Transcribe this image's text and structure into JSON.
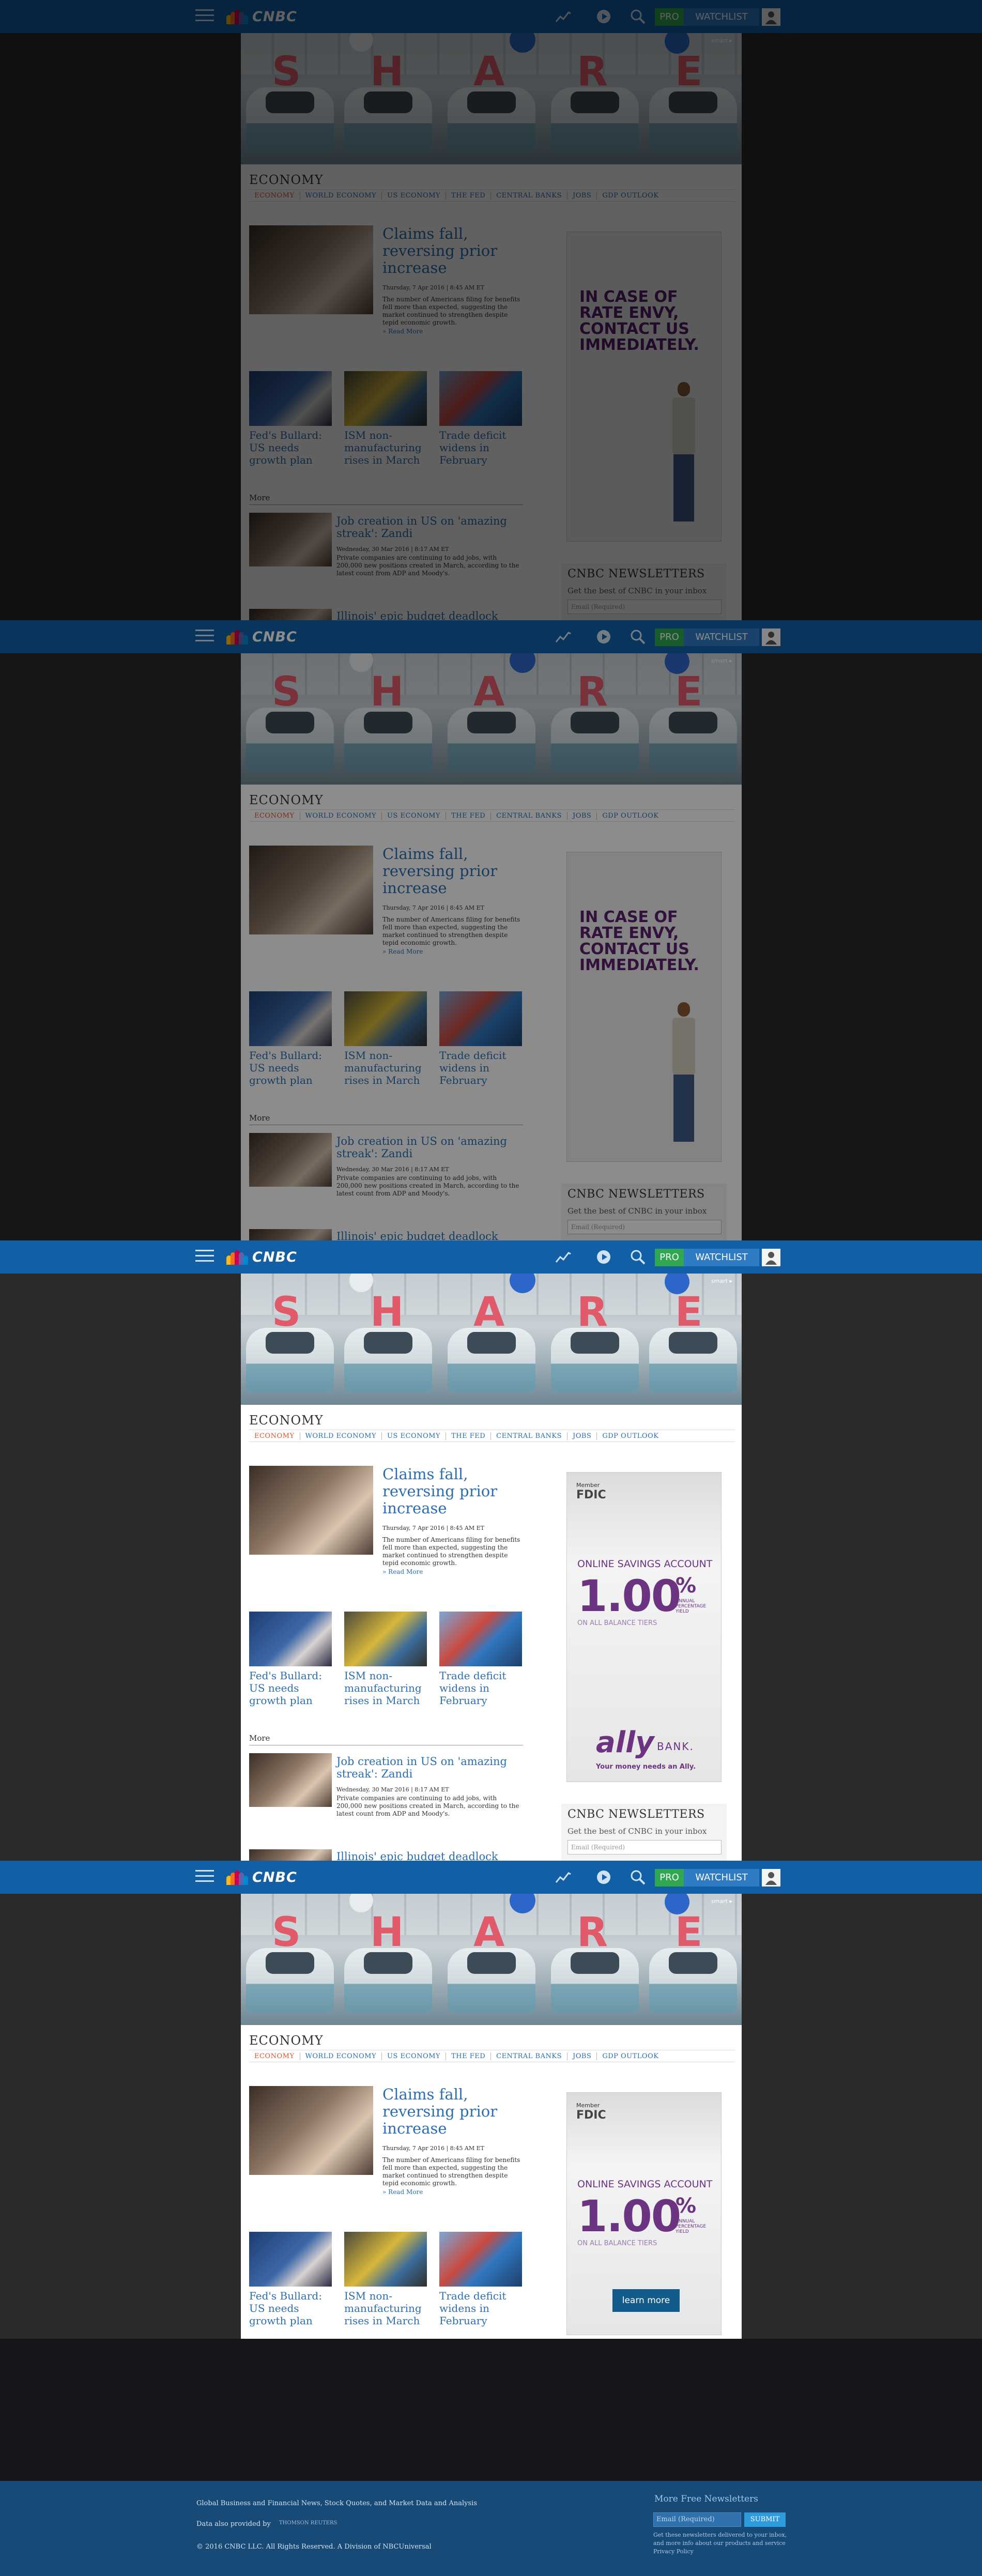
{
  "nav": {
    "logo_text": "CNBC",
    "pro_label": "PRO",
    "watchlist_label": "WATCHLIST"
  },
  "hero": {
    "letters": [
      "S",
      "H",
      "A",
      "R",
      "E"
    ],
    "caption": "smart ▸"
  },
  "section": {
    "title": "ECONOMY",
    "tabs": [
      "ECONOMY",
      "WORLD ECONOMY",
      "US ECONOMY",
      "THE FED",
      "CENTRAL BANKS",
      "JOBS",
      "GDP OUTLOOK"
    ]
  },
  "lead": {
    "headline": "Claims fall, reversing prior increase",
    "date": "Thursday, 7 Apr 2016 | 8:45 AM ET",
    "summary": "The number of Americans filing for benefits fell more than expected, suggesting the market continued to strengthen despite tepid economic growth.",
    "read_more": "» Read More"
  },
  "cards": [
    {
      "title": "Fed's Bullard: US needs growth plan"
    },
    {
      "title": "ISM non-manufacturing rises in March"
    },
    {
      "title": "Trade deficit widens in February"
    }
  ],
  "more": {
    "label": "More",
    "items": [
      {
        "title": "Job creation in US on 'amazing streak': Zandi",
        "date": "Wednesday, 30 Mar 2016 | 8:17 AM ET",
        "summary": "Private companies are continuing to add jobs, with 200,000 new positions created in March, according to the latest count from ADP and Moody's."
      },
      {
        "title": "Illinois' epic budget deadlock"
      }
    ]
  },
  "ads": {
    "rate_envy": "IN CASE OF RATE ENVY, CONTACT US IMMEDIATELY.",
    "member": "Member",
    "fdic": "FDIC",
    "account": "ONLINE SAVINGS ACCOUNT",
    "rate": "1.00",
    "pct": "%",
    "apy": "ANNUAL PERCENTAGE YIELD",
    "tiers": "ON ALL BALANCE TIERS",
    "learn_more": "learn more",
    "brand": "ally",
    "bank": "BANK.",
    "tagline": "Your money needs an Ally."
  },
  "newsletter": {
    "title": "CNBC NEWSLETTERS",
    "subtitle": "Get the best of CNBC in your inbox",
    "placeholder": "Email (Required)"
  },
  "footer": {
    "line1": "Global Business and Financial News, Stock Quotes, and Market Data and Analysis",
    "data_by": "Data also provided by",
    "provider": "THOMSON REUTERS",
    "copyright": "© 2016 CNBC LLC. All Rights Reserved. A Division of NBCUniversal",
    "nl_title": "More Free Newsletters",
    "nl_placeholder": "Email (Required)",
    "nl_button": "SUBMIT",
    "nl_text": "Get these newsletters delivered to your inbox, and more info about our products and service Privacy Policy"
  }
}
